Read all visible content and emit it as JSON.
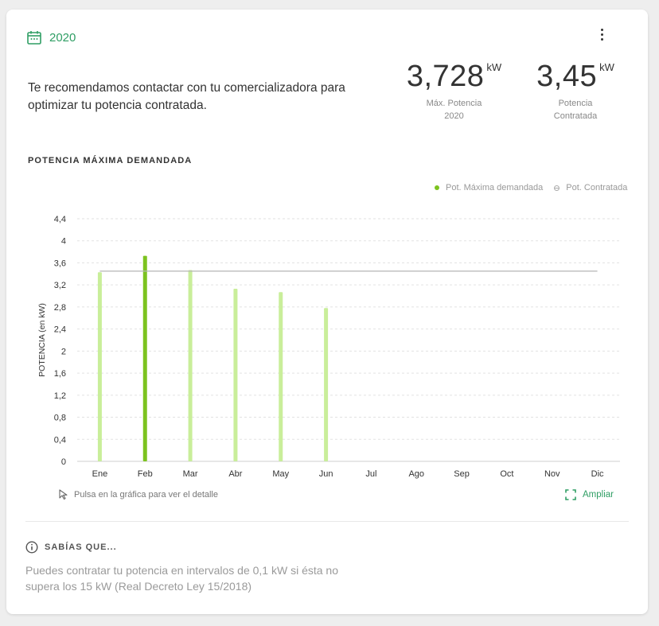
{
  "header": {
    "year": "2020",
    "recommendation": "Te recomendamos contactar con tu comercializadora para optimizar tu potencia contratada."
  },
  "kpis": {
    "max": {
      "value": "3,728",
      "unit": "kW",
      "caption_line1": "Máx. Potencia",
      "caption_line2": "2020"
    },
    "contracted": {
      "value": "3,45",
      "unit": "kW",
      "caption_line1": "Potencia",
      "caption_line2": "Contratada"
    }
  },
  "section_title": "POTENCIA MÁXIMA DEMANDADA",
  "legend": {
    "max_label": "Pot. Máxima demandada",
    "contracted_label": "Pot. Contratada"
  },
  "chart_data": {
    "type": "bar",
    "categories": [
      "Ene",
      "Feb",
      "Mar",
      "Abr",
      "May",
      "Jun",
      "Jul",
      "Ago",
      "Sep",
      "Oct",
      "Nov",
      "Dic"
    ],
    "series": [
      {
        "name": "Pot. Máxima demandada",
        "values": [
          3.43,
          3.728,
          3.47,
          3.13,
          3.07,
          2.78,
          null,
          null,
          null,
          null,
          null,
          null
        ]
      }
    ],
    "highlight_index": 1,
    "reference_line": {
      "name": "Pot. Contratada",
      "value": 3.45
    },
    "yticks": [
      "0",
      "0,4",
      "0,8",
      "1,2",
      "1,6",
      "2",
      "2,4",
      "2,8",
      "3,2",
      "3,6",
      "4",
      "4,4"
    ],
    "ylabel": "POTENCIA (en kW)",
    "ylim": [
      0,
      4.4
    ],
    "grid": true,
    "legend_position": "top-right",
    "colors": {
      "bar": "#c9ee9a",
      "bar_highlight": "#7cc31f",
      "reference": "#b5b5b5",
      "grid": "#e2e2e2"
    }
  },
  "footer": {
    "hint": "Pulsa en la gráfica para ver el detalle",
    "expand_label": "Ampliar",
    "tip_title": "SABÍAS QUE...",
    "tip_text": "Puedes contratar tu potencia en intervalos de 0,1 kW si ésta no supera los 15 kW (Real Decreto Ley 15/2018)"
  },
  "colors": {
    "accent": "#2f9e64"
  },
  "icons": {
    "year": "calendar-icon",
    "menu": "more-vertical-icon",
    "hint": "cursor-icon",
    "expand": "expand-icon",
    "tip": "info-icon"
  }
}
